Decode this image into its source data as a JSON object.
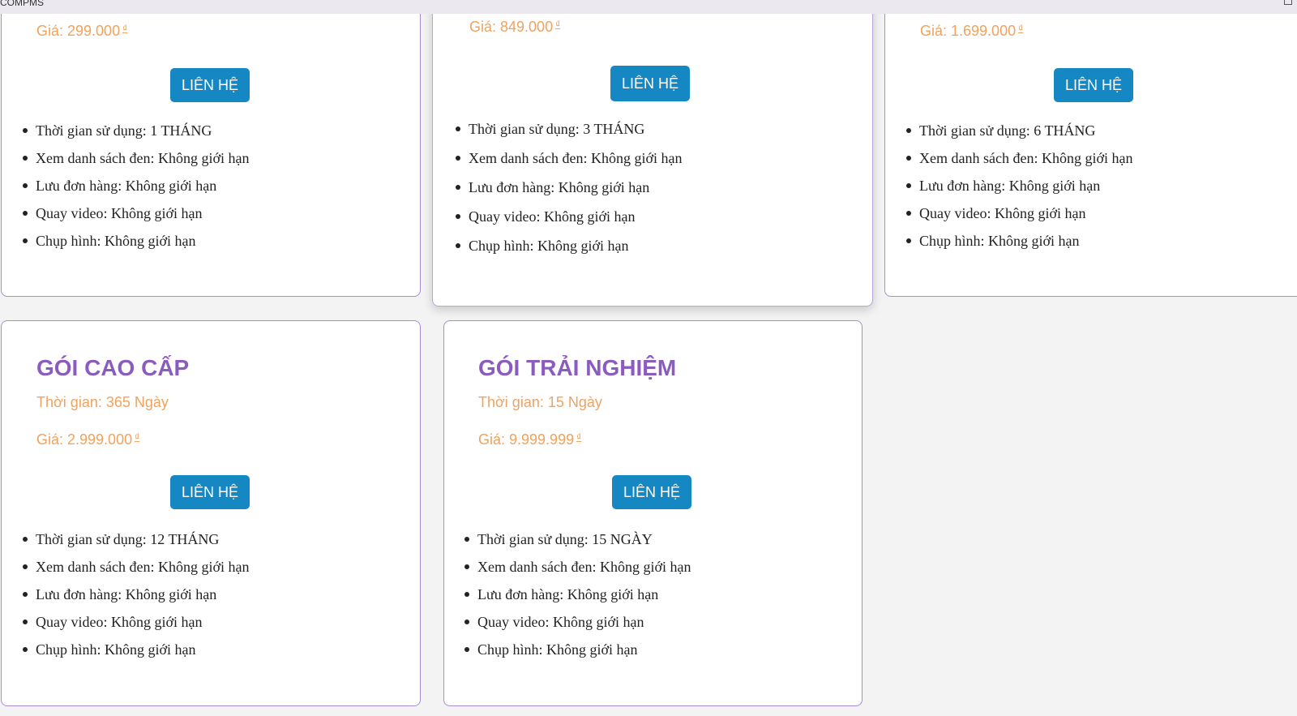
{
  "window": {
    "title": "COMPMS"
  },
  "colors": {
    "title": "#8a5cc0",
    "accent": "#f0a25e",
    "button": "#1588c4",
    "border": "#a98bd4"
  },
  "packages": [
    {
      "price": "Giá: 299.000",
      "currency": "₫",
      "button_label": "LIÊN HỆ",
      "features": [
        "Thời gian sử dụng: 1 THÁNG",
        "Xem danh sách đen: Không giới hạn",
        "Lưu đơn hàng: Không giới hạn",
        "Quay video: Không giới hạn",
        "Chụp hình: Không giới hạn"
      ]
    },
    {
      "price": "Giá: 849.000",
      "currency": "₫",
      "button_label": "LIÊN HỆ",
      "features": [
        "Thời gian sử dụng: 3 THÁNG",
        "Xem danh sách đen: Không giới hạn",
        "Lưu đơn hàng: Không giới hạn",
        "Quay video: Không giới hạn",
        "Chụp hình: Không giới hạn"
      ]
    },
    {
      "price": "Giá: 1.699.000",
      "currency": "₫",
      "button_label": "LIÊN HỆ",
      "features": [
        "Thời gian sử dụng: 6 THÁNG",
        "Xem danh sách đen: Không giới hạn",
        "Lưu đơn hàng: Không giới hạn",
        "Quay video: Không giới hạn",
        "Chụp hình: Không giới hạn"
      ]
    },
    {
      "title": "GÓI CAO CẤP",
      "duration": "Thời gian: 365 Ngày",
      "price": "Giá: 2.999.000",
      "currency": "₫",
      "button_label": "LIÊN HỆ",
      "features": [
        "Thời gian sử dụng: 12 THÁNG",
        "Xem danh sách đen: Không giới hạn",
        "Lưu đơn hàng: Không giới hạn",
        "Quay video: Không giới hạn",
        "Chụp hình: Không giới hạn"
      ]
    },
    {
      "title": "GÓI TRẢI NGHIỆM",
      "duration": "Thời gian: 15 Ngày",
      "price": "Giá: 9.999.999",
      "currency": "₫",
      "button_label": "LIÊN HỆ",
      "features": [
        "Thời gian sử dụng: 15 NGÀY",
        "Xem danh sách đen: Không giới hạn",
        "Lưu đơn hàng: Không giới hạn",
        "Quay video: Không giới hạn",
        "Chụp hình: Không giới hạn"
      ]
    }
  ]
}
